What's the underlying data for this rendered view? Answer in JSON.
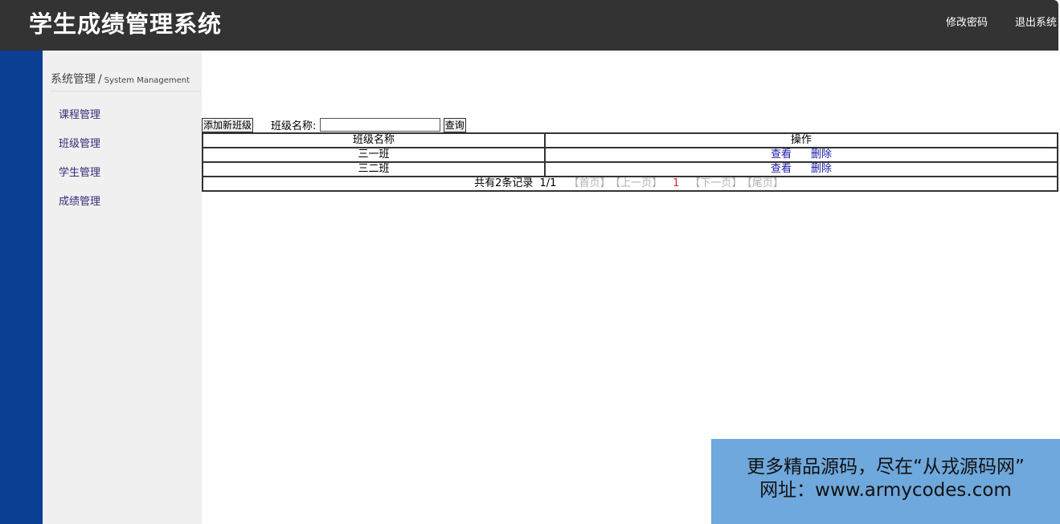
{
  "header": {
    "title": "学生成绩管理系统",
    "links": [
      "修改密码",
      "退出系统"
    ]
  },
  "sidebar": {
    "heading_zh": "系统管理",
    "heading_sep": "/",
    "heading_en": "System Management",
    "items": [
      {
        "label": "课程管理"
      },
      {
        "label": "班级管理"
      },
      {
        "label": "学生管理"
      },
      {
        "label": "成绩管理"
      }
    ]
  },
  "toolbar": {
    "add_label": "添加新班级",
    "search_label": "班级名称:",
    "search_value": "",
    "query_label": "查询"
  },
  "table": {
    "headers": [
      "班级名称",
      "操作"
    ],
    "rows": [
      {
        "name": "三一班",
        "view": "查看",
        "delete": "删除"
      },
      {
        "name": "三二班",
        "view": "查看",
        "delete": "删除"
      }
    ]
  },
  "pager": {
    "summary": "共有2条记录",
    "page_info": "1/1",
    "first": "【首页】",
    "prev": "【上一页】",
    "current": "1",
    "next": "【下一页】",
    "last": "【尾页】"
  },
  "watermark": {
    "line1": "更多精品源码，尽在“从戎源码网”",
    "line2": "网址：www.armycodes.com"
  },
  "colors": {
    "topbar": "#333333",
    "left_strip": "#0a3f94",
    "sidebar_bg": "#f0f0f0",
    "link": "#1a1aa6",
    "pager_current": "#e02020",
    "watermark_bg": "#6fa8dc"
  }
}
